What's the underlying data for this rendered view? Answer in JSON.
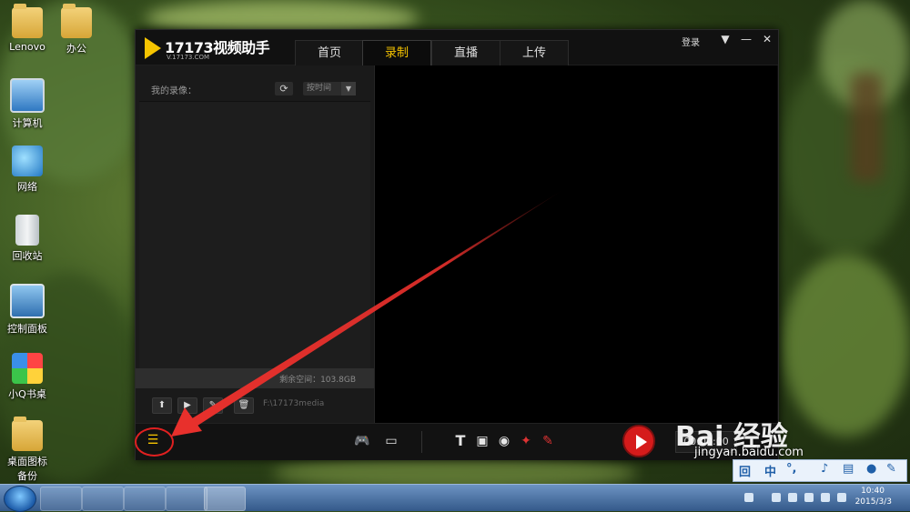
{
  "desktop": {
    "icons": [
      {
        "label": "Lenovo",
        "icon": "folder-icon"
      },
      {
        "label": "办公",
        "icon": "folder-icon"
      },
      {
        "label": "计算机",
        "icon": "computer-icon"
      },
      {
        "label": "网络",
        "icon": "network-icon"
      },
      {
        "label": "回收站",
        "icon": "recycle-bin-icon"
      },
      {
        "label": "控制面板",
        "icon": "control-panel-icon"
      },
      {
        "label": "小Q书桌",
        "icon": "qq-desk-icon"
      },
      {
        "label": "桌面图标备份",
        "icon": "folder-icon"
      }
    ]
  },
  "app": {
    "logo_name": "17173视频助手",
    "logo_url": "V.17173.COM",
    "tabs": [
      "首页",
      "录制",
      "直播",
      "上传"
    ],
    "active_tab": "录制",
    "login": "登录",
    "left_panel": {
      "title": "我的录像：",
      "sort_label": "按时间",
      "remaining_space": "剩余空间：103.8GB",
      "path": "F:\\17173media"
    },
    "bottom_bar": {
      "timer": "00:00:00"
    },
    "accent_color": "#f6c400",
    "record_color": "#d51b1b"
  },
  "taskbar": {
    "time": "10:40",
    "date": "2015/3/3"
  },
  "ime": [
    "中",
    "°,"
  ],
  "watermark": {
    "brand": "Bai 经验",
    "url": "jingyan.baidu.com"
  }
}
